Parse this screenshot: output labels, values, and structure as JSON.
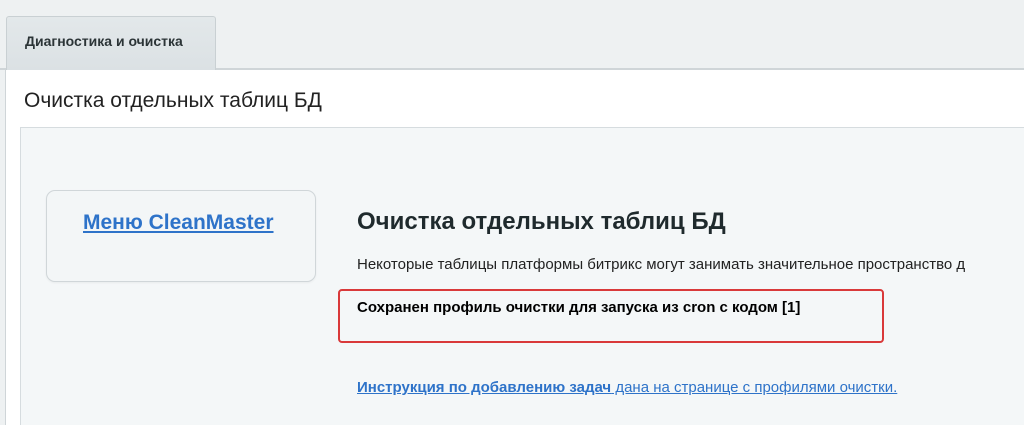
{
  "tabs": [
    {
      "label": "Диагностика и очистка"
    }
  ],
  "page_title": "Очистка отдельных таблиц БД",
  "menu": {
    "link_label": "Меню CleanMaster"
  },
  "main": {
    "heading": "Очистка отдельных таблиц БД",
    "description": "Некоторые таблицы платформы битрикс могут занимать значительное пространство д",
    "notice": "Сохранен профиль очистки для запуска из cron с кодом [1]",
    "instruction_link": "Инструкция по добавлению задач",
    "instruction_rest": " дана на странице с профилями очистки."
  },
  "colors": {
    "link": "#2e73c9",
    "notice_border": "#d9393a",
    "background": "#eef1f2"
  }
}
